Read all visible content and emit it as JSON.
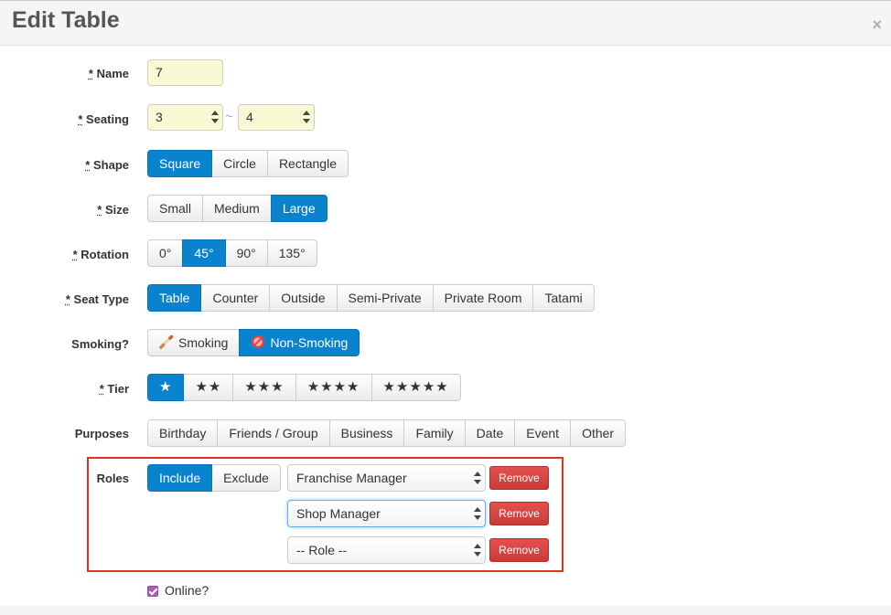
{
  "header": {
    "title": "Edit Table",
    "close_label": "×"
  },
  "form": {
    "name": {
      "label": "Name",
      "value": "7",
      "required_mark": "*"
    },
    "seating": {
      "label": "Seating",
      "required_mark": "*",
      "min": "3",
      "max": "4",
      "separator": "~"
    },
    "shape": {
      "label": "Shape",
      "required_mark": "*",
      "options": [
        "Square",
        "Circle",
        "Rectangle"
      ],
      "selected": "Square"
    },
    "size": {
      "label": "Size",
      "required_mark": "*",
      "options": [
        "Small",
        "Medium",
        "Large"
      ],
      "selected": "Large"
    },
    "rotation": {
      "label": "Rotation",
      "required_mark": "*",
      "options": [
        "0°",
        "45°",
        "90°",
        "135°"
      ],
      "selected": "45°"
    },
    "seat_type": {
      "label": "Seat Type",
      "required_mark": "*",
      "options": [
        "Table",
        "Counter",
        "Outside",
        "Semi-Private",
        "Private Room",
        "Tatami"
      ],
      "selected": "Table"
    },
    "smoking": {
      "label": "Smoking?",
      "options": [
        "Smoking",
        "Non-Smoking"
      ],
      "selected": "Non-Smoking",
      "icons": [
        "cigarette-icon",
        "no-smoking-icon"
      ]
    },
    "tier": {
      "label": "Tier",
      "required_mark": "*",
      "options": [
        "★",
        "★★",
        "★★★",
        "★★★★",
        "★★★★★"
      ],
      "selected": "★"
    },
    "purposes": {
      "label": "Purposes",
      "options": [
        "Birthday",
        "Friends / Group",
        "Business",
        "Family",
        "Date",
        "Event",
        "Other"
      ]
    },
    "roles": {
      "label": "Roles",
      "mode_options": [
        "Include",
        "Exclude"
      ],
      "mode_selected": "Include",
      "selects": [
        "Franchise Manager",
        "Shop Manager",
        "-- Role --"
      ],
      "remove_label": "Remove"
    },
    "online": {
      "label": "Online?",
      "checked": true
    }
  },
  "colors": {
    "primary": "#0a83cf",
    "danger": "#d9534f",
    "highlight_box": "#e0331f",
    "input_bg": "#fbf9d3",
    "checkbox": "#b05bb8"
  }
}
